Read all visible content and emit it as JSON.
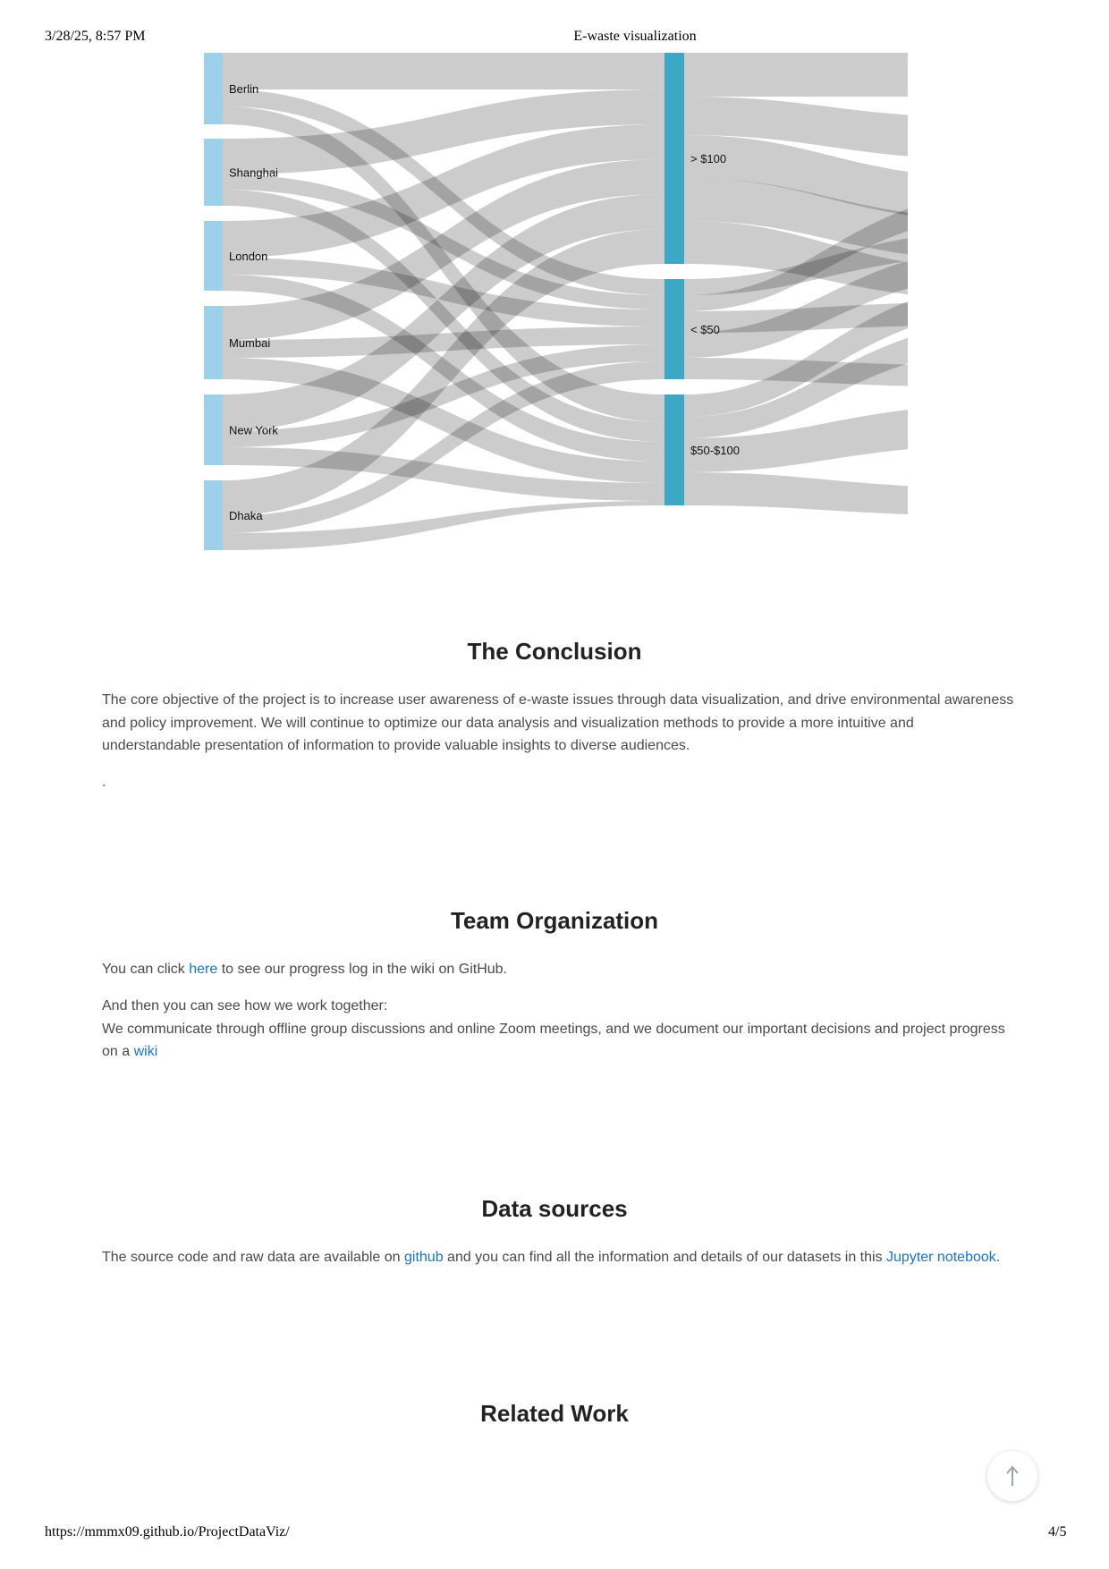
{
  "print_header": {
    "datetime": "3/28/25, 8:57 PM",
    "title": "E-waste visualization"
  },
  "print_footer": {
    "url": "https://mmmx09.github.io/ProjectDataViz/",
    "page": "4/5"
  },
  "chart_data": {
    "type": "sankey",
    "source_nodes": [
      "Berlin",
      "Shanghai",
      "London",
      "Mumbai",
      "New York",
      "Dhaka"
    ],
    "target_nodes": [
      "> $100",
      "< $50",
      "$50-$100"
    ],
    "colors": {
      "source": "#9dd1ea",
      "target": "#3da8c6",
      "link": "#cccccc"
    }
  },
  "sections": {
    "conclusion": {
      "title": "The Conclusion",
      "text": "The core objective of the project is to increase user awareness of e-waste issues through data visualization, and drive environmental awareness and policy improvement. We will continue to optimize our data analysis and visualization methods to provide a more intuitive and understandable presentation of information to provide valuable insights to diverse audiences.",
      "trailing": "."
    },
    "team": {
      "title": "Team Organization",
      "p1_before": "You can click ",
      "p1_link": "here",
      "p1_after": " to see our progress log in the wiki on GitHub.",
      "p2_line1": "And then you can see how we work together:",
      "p2_line2": "We communicate through offline group discussions and online Zoom meetings, and we document our important decisions and project progress on a ",
      "p2_link": "wiki"
    },
    "data_sources": {
      "title": "Data sources",
      "before": "The source code and raw data are available on ",
      "link1": "github",
      "middle": " and you can find all the information and details of our datasets in this ",
      "link2": "Jupyter notebook",
      "after": "."
    },
    "related_work": {
      "title": "Related Work"
    }
  },
  "scroll_top": {
    "icon": "arrow-up-icon",
    "glyph": "↑"
  }
}
